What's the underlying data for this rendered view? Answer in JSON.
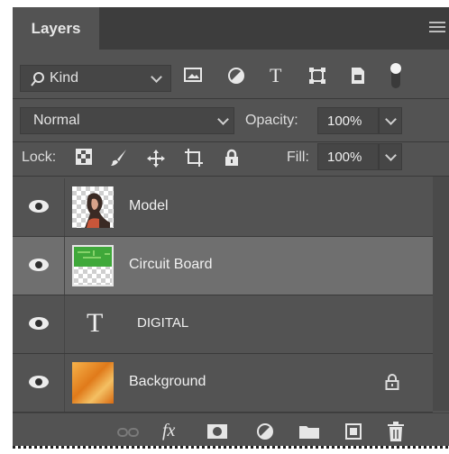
{
  "panel": {
    "tab_title": "Layers"
  },
  "filter": {
    "kind_label": "Kind",
    "icons": [
      "image-filter-icon",
      "adjustment-filter-icon",
      "type-filter-icon",
      "shape-filter-icon",
      "smart-object-filter-icon",
      "filter-toggle-icon"
    ]
  },
  "blend": {
    "mode": "Normal",
    "opacity_label": "Opacity:",
    "opacity_value": "100%"
  },
  "lock": {
    "label": "Lock:",
    "icons": [
      "lock-transparent-icon",
      "lock-image-icon",
      "lock-position-icon",
      "lock-artboard-icon",
      "lock-all-icon"
    ],
    "fill_label": "Fill:",
    "fill_value": "100%"
  },
  "layers": [
    {
      "name": "Model",
      "selected": false,
      "type": "pixel"
    },
    {
      "name": "Circuit Board",
      "selected": true,
      "type": "pixel"
    },
    {
      "name": "DIGITAL",
      "selected": false,
      "type": "text",
      "glyph": "T"
    },
    {
      "name": "Background",
      "selected": false,
      "type": "pixel",
      "locked": true
    }
  ],
  "bottom_bar": {
    "icons": [
      "link-icon",
      "fx-icon",
      "mask-icon",
      "adjustment-icon",
      "folder-icon",
      "new-layer-icon",
      "trash-icon"
    ],
    "fx_text": "fx"
  },
  "colors": {
    "panel_bg": "#535353",
    "selected_row": "#6f6f6f",
    "field_bg": "#464646"
  }
}
